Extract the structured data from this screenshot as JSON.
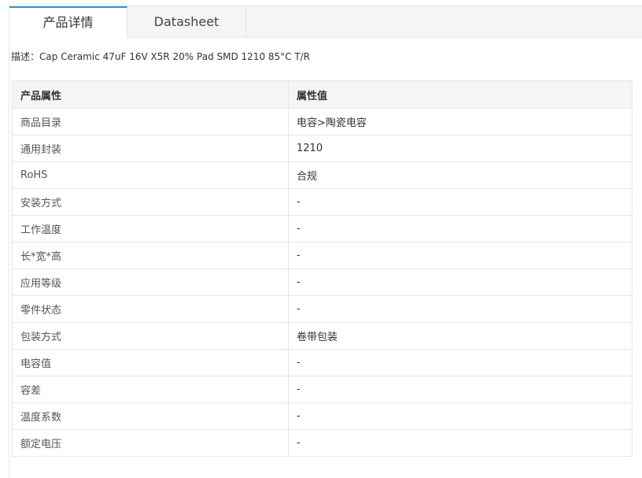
{
  "tabs": [
    {
      "label": "产品详情",
      "active": true
    },
    {
      "label": "Datasheet",
      "active": false
    }
  ],
  "description": "描述：Cap Ceramic 47uF 16V X5R 20% Pad SMD 1210 85°C T/R",
  "table": {
    "headers": [
      "产品属性",
      "属性值"
    ],
    "rows": [
      {
        "key": "商品目录",
        "value": "电容>陶瓷电容"
      },
      {
        "key": "通用封装",
        "value": "1210"
      },
      {
        "key": "RoHS",
        "value": "合规"
      },
      {
        "key": "安装方式",
        "value": "-"
      },
      {
        "key": "工作温度",
        "value": "-"
      },
      {
        "key": "长*宽*高",
        "value": "-"
      },
      {
        "key": "应用等级",
        "value": "-"
      },
      {
        "key": "零件状态",
        "value": "-"
      },
      {
        "key": "包装方式",
        "value": "卷带包装"
      },
      {
        "key": "电容值",
        "value": "-"
      },
      {
        "key": "容差",
        "value": "-"
      },
      {
        "key": "温度系数",
        "value": "-"
      },
      {
        "key": "额定电压",
        "value": "-"
      }
    ]
  },
  "colors": {
    "accent": "#2f8fdc",
    "tabbar_bg": "#f5f5f5",
    "border": "#e6e6e6"
  }
}
